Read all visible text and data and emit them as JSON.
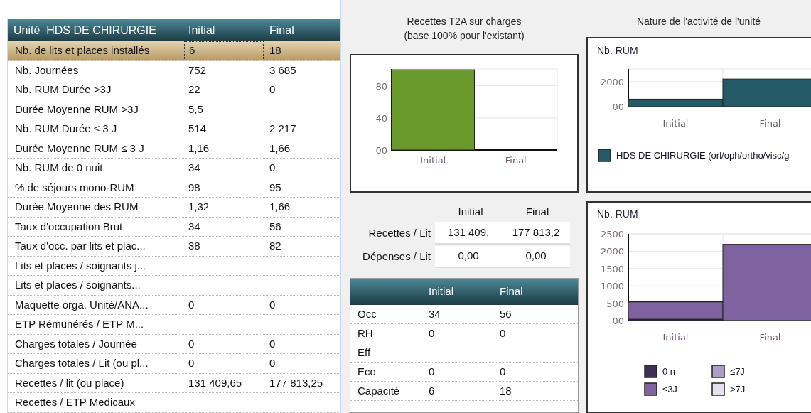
{
  "unit_table": {
    "columns": [
      "Unité  HDS DE CHIRURGIE",
      "Initial",
      "Final"
    ],
    "rows": [
      {
        "label": "Nb. de lits et places installés",
        "initial": "6",
        "final": "18",
        "selected": true
      },
      {
        "label": "Nb. Journées",
        "initial": "752",
        "final": "3 685",
        "selected": false
      },
      {
        "label": "Nb. RUM Durée >3J",
        "initial": "22",
        "final": "0",
        "selected": false
      },
      {
        "label": "Durée Moyenne RUM >3J",
        "initial": "5,5",
        "selected": false
      },
      {
        "label": "Nb. RUM Durée ≤ 3 J",
        "initial": "514",
        "final": "2 217",
        "selected": false
      },
      {
        "label": "Durée Moyenne RUM ≤ 3 J",
        "initial": "1,16",
        "final": "1,66",
        "selected": false
      },
      {
        "label": "Nb. RUM de 0 nuit",
        "initial": "34",
        "final": "0",
        "selected": false
      },
      {
        "label": "% de séjours mono-RUM",
        "initial": "98",
        "final": "95",
        "selected": false
      },
      {
        "label": "Durée Moyenne des RUM",
        "initial": "1,32",
        "final": "1,66",
        "selected": false
      },
      {
        "label": "Taux d'occupation Brut",
        "initial": "34",
        "final": "56",
        "selected": false
      },
      {
        "label": "Taux d'occ. par lits et plac...",
        "initial": "38",
        "final": "82",
        "selected": false
      },
      {
        "label": "Lits et places / soignants j...",
        "selected": false
      },
      {
        "label": "Lits et places / soignants...",
        "selected": false
      },
      {
        "label": "Maquette orga. Unité/ANA...",
        "initial": "0",
        "final": "0",
        "selected": false
      },
      {
        "label": "ETP Rémunérés / ETP M...",
        "selected": false
      },
      {
        "label": "Charges totales / Journée",
        "initial": "0",
        "final": "0",
        "selected": false
      },
      {
        "label": "Charges totales / Lit (ou pl...",
        "initial": "0",
        "final": "0",
        "selected": false
      },
      {
        "label": "Recettes / lit (ou place)",
        "initial": "131 409,65",
        "final": "177 813,25",
        "selected": false
      },
      {
        "label": "Recettes / ETP Medicaux",
        "selected": false
      }
    ]
  },
  "revenue_chart": {
    "chart_data": {
      "type": "bar",
      "grid": true,
      "title": "Recettes T2A sur charges\n(base 100% pour l'existant)",
      "categories": [
        "Initial",
        "Final"
      ],
      "series": [
        {
          "color": "#6b9a2c",
          "values": [
            100,
            0
          ]
        }
      ],
      "ylim": [
        0,
        101
      ],
      "yticks": [
        {
          "value": 0,
          "label": "00"
        },
        40,
        80
      ]
    }
  },
  "per_bed": {
    "columns": [
      "Initial",
      "Final"
    ],
    "rows": [
      {
        "label": "Recettes / Lit",
        "initial": "131 409,",
        "final": "177 813,2"
      },
      {
        "label": "Dépenses / Lit",
        "initial": "0,00",
        "final": "0,00"
      }
    ]
  },
  "indicators": {
    "columns": [
      "Initial",
      "Final"
    ],
    "rows": [
      {
        "label": "Occ",
        "initial": "34",
        "final": "56"
      },
      {
        "label": "RH",
        "initial": "0",
        "final": "0"
      },
      {
        "label": "Eff"
      },
      {
        "label": "Eco",
        "initial": "0",
        "final": "0"
      },
      {
        "label": "Capacité",
        "initial": "6",
        "final": "18"
      }
    ]
  },
  "activity": {
    "title": "Nature de l'activité de l'unité",
    "charts": [
      {
        "chart_data": {
          "type": "bar",
          "grid": true,
          "legend": "bottom",
          "ylabel": "Nb. RUM",
          "categories": [
            "Initial",
            "Final"
          ],
          "series": [
            {
              "name": "HDS DE CHIRURGIE (orl/oph/ortho/visc/g",
              "color": "#245a68",
              "values": [
                600,
                2200
              ]
            }
          ],
          "ylim": [
            0,
            3000
          ],
          "yticks": [
            {
              "value": 0,
              "label": "00"
            },
            2000
          ]
        }
      },
      {
        "chart_data": {
          "type": "bar",
          "grid": true,
          "legend": "bottom",
          "stacked": true,
          "ylabel": "Nb. RUM",
          "categories": [
            "Initial",
            "Final"
          ],
          "series": [
            {
              "name": "0 n",
              "color": "#3f2f55",
              "values": [
                40,
                0
              ]
            },
            {
              "name": "≤3J",
              "color": "#7f62a0",
              "values": [
                500,
                2200
              ]
            },
            {
              "name": "≤7J",
              "color": "#b09cc8",
              "values": [
                20,
                0
              ]
            },
            {
              "name": ">7J",
              "color": "#e6e0ee",
              "values": [
                0,
                0
              ]
            }
          ],
          "ylim": [
            0,
            2500
          ],
          "yticks": [
            {
              "value": 0,
              "label": "00"
            },
            500,
            1000,
            1500,
            2000,
            2500
          ]
        }
      }
    ]
  }
}
